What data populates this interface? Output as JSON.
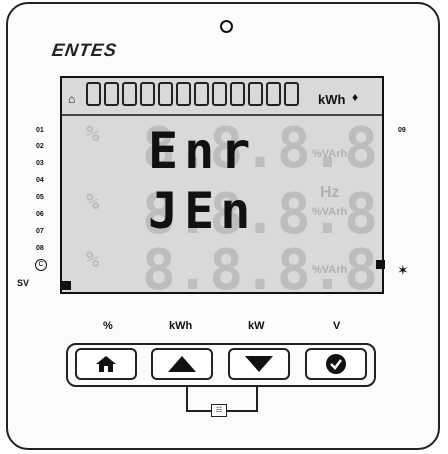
{
  "device": {
    "brand": "ENTES"
  },
  "display": {
    "top_unit": "kWh",
    "line1": "Enr",
    "line2": "JEn",
    "ghost_unit_1": "%VArh",
    "ghost_unit_2": "%VArh",
    "ghost_unit_3": "%VArh",
    "ghost_hz": "Hz",
    "ghost_pct": "%"
  },
  "row_labels": [
    "01",
    "02",
    "03",
    "04",
    "05",
    "06",
    "07",
    "08"
  ],
  "right_label": "09",
  "sv_label": "SV",
  "keys": [
    {
      "label": "%",
      "icon": "home-icon"
    },
    {
      "label": "kWh",
      "icon": "arrow-up-icon"
    },
    {
      "label": "kW",
      "icon": "arrow-down-icon"
    },
    {
      "label": "V",
      "icon": "check-icon"
    }
  ]
}
